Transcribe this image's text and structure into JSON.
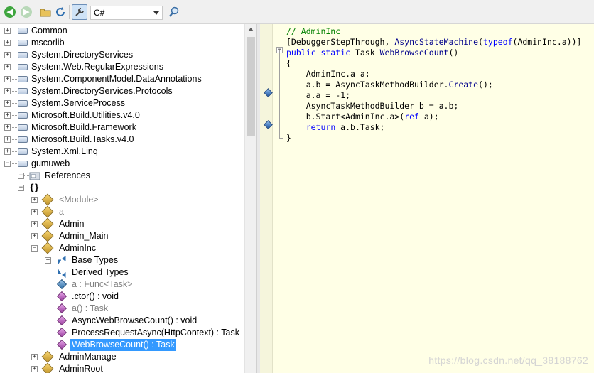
{
  "toolbar": {
    "language": "C#"
  },
  "tree": {
    "items": [
      {
        "label": "Common"
      },
      {
        "label": "mscorlib"
      },
      {
        "label": "System.DirectoryServices"
      },
      {
        "label": "System.Web.RegularExpressions"
      },
      {
        "label": "System.ComponentModel.DataAnnotations"
      },
      {
        "label": "System.DirectoryServices.Protocols"
      },
      {
        "label": "System.ServiceProcess"
      },
      {
        "label": "Microsoft.Build.Utilities.v4.0"
      },
      {
        "label": "Microsoft.Build.Framework"
      },
      {
        "label": "Microsoft.Build.Tasks.v4.0"
      },
      {
        "label": "System.Xml.Linq"
      },
      {
        "label": "gumuweb"
      },
      {
        "label": "References"
      },
      {
        "label": "-"
      },
      {
        "label": "<Module>"
      },
      {
        "label": "a"
      },
      {
        "label": "Admin"
      },
      {
        "label": "Admin_Main"
      },
      {
        "label": "AdminInc"
      },
      {
        "label": "Base Types"
      },
      {
        "label": "Derived Types"
      },
      {
        "label": "a : Func<Task>"
      },
      {
        "label": ".ctor() : void"
      },
      {
        "label": "a() : Task"
      },
      {
        "label": "AsyncWebBrowseCount() : void"
      },
      {
        "label": "ProcessRequestAsync(HttpContext) : Task"
      },
      {
        "label": "WebBrowseCount() : Task"
      },
      {
        "label": "AdminManage"
      },
      {
        "label": "AdminRoot"
      }
    ]
  },
  "code": {
    "lines": [
      {
        "parts": [
          [
            "c-comment",
            "// AdminInc"
          ]
        ]
      },
      {
        "parts": [
          [
            "c-type",
            "[DebuggerStepThrough, "
          ],
          [
            "c-ref",
            "AsyncStateMachine"
          ],
          [
            "c-type",
            "("
          ],
          [
            "c-kw",
            "typeof"
          ],
          [
            "c-type",
            "(AdminInc.a))]"
          ]
        ]
      },
      {
        "parts": [
          [
            "c-kw",
            "public static "
          ],
          [
            "c-type",
            "Task "
          ],
          [
            "c-ref",
            "WebBrowseCount"
          ],
          [
            "c-type",
            "()"
          ]
        ]
      },
      {
        "parts": [
          [
            "c-type",
            "{"
          ]
        ]
      },
      {
        "parts": [
          [
            "c-type",
            "    AdminInc.a a;"
          ]
        ]
      },
      {
        "parts": [
          [
            "c-type",
            "    a.b = AsyncTaskMethodBuilder."
          ],
          [
            "c-ref",
            "Create"
          ],
          [
            "c-type",
            "();"
          ]
        ]
      },
      {
        "parts": [
          [
            "c-type",
            "    a.a = -1;"
          ]
        ]
      },
      {
        "parts": [
          [
            "c-type",
            "    AsyncTaskMethodBuilder b = a.b;"
          ]
        ]
      },
      {
        "parts": [
          [
            "c-type",
            "    b.Start<AdminInc.a>("
          ],
          [
            "c-kw",
            "ref"
          ],
          [
            "c-type",
            " a);"
          ]
        ]
      },
      {
        "parts": [
          [
            "c-type",
            "    "
          ],
          [
            "c-kw",
            "return"
          ],
          [
            "c-type",
            " a.b.Task;"
          ]
        ]
      },
      {
        "parts": [
          [
            "c-type",
            "}"
          ]
        ]
      }
    ]
  },
  "watermark": "https://blog.csdn.net/qq_38188762"
}
